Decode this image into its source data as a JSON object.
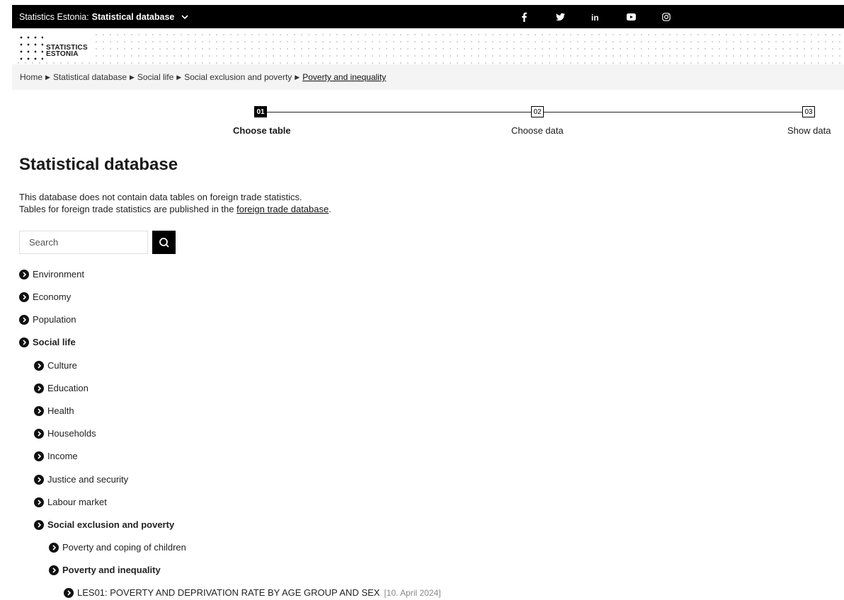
{
  "topbar": {
    "site": "Statistics Estonia:",
    "section": "Statistical database",
    "socials": [
      {
        "icon": "facebook-icon",
        "glyph": "f"
      },
      {
        "icon": "twitter-icon",
        "glyph": "🐦"
      },
      {
        "icon": "linkedin-icon",
        "glyph": "in"
      },
      {
        "icon": "youtube-icon",
        "glyph": "▶"
      },
      {
        "icon": "instagram-icon",
        "glyph": "◎"
      }
    ]
  },
  "logo": {
    "line1": "STATISTICS",
    "line2": "ESTONIA"
  },
  "breadcrumb": [
    "Home",
    "Statistical database",
    "Social life",
    "Social exclusion and poverty",
    "Poverty and inequality"
  ],
  "steps": [
    {
      "num": "01",
      "label": "Choose table"
    },
    {
      "num": "02",
      "label": "Choose data"
    },
    {
      "num": "03",
      "label": "Show data"
    }
  ],
  "page_title": "Statistical database",
  "notice": {
    "line1": "This database does not contain data tables on foreign trade statistics.",
    "line2_before": "Tables for foreign trade statistics are published in the ",
    "line2_link": "foreign trade database",
    "line2_after": "."
  },
  "search": {
    "placeholder": "Search"
  },
  "tree": [
    {
      "label": "Environment"
    },
    {
      "label": "Economy"
    },
    {
      "label": "Population"
    },
    {
      "label": "Social life"
    },
    {
      "label": "Culture"
    },
    {
      "label": "Education"
    },
    {
      "label": "Health"
    },
    {
      "label": "Households"
    },
    {
      "label": "Income"
    },
    {
      "label": "Justice and security"
    },
    {
      "label": "Labour market"
    },
    {
      "label": "Social exclusion and poverty"
    },
    {
      "label": "Poverty and coping of children"
    },
    {
      "label": "Poverty and inequality"
    },
    {
      "label": "LES01: POVERTY AND DEPRIVATION RATE BY AGE GROUP AND SEX",
      "date": "[10. April 2024]"
    }
  ]
}
